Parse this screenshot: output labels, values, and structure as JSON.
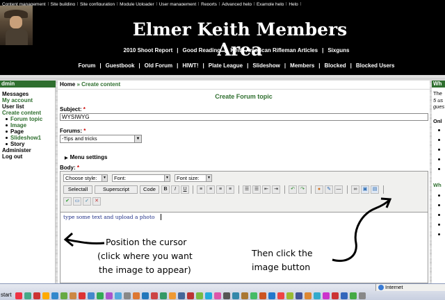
{
  "admin_bar": {
    "items": [
      "Content management",
      "Site building",
      "Site configuration",
      "Module Uploader",
      "User management",
      "Reports",
      "Advanced help",
      "Example help",
      "Help"
    ]
  },
  "header": {
    "site_title": "Elmer Keith Members Area",
    "primary_links": [
      "2010 Shoot Report",
      "Good Reading",
      "Keith American Rifleman Articles",
      "Sixguns"
    ],
    "secondary_links": [
      "Forum",
      "Guestbook",
      "Old Forum",
      "HIWT!",
      "Plate League",
      "Slideshow",
      "Members",
      "Blocked",
      "Blocked Users"
    ]
  },
  "sidebar": {
    "title": "dmin",
    "items": [
      {
        "label": "Messages",
        "style": "black"
      },
      {
        "label": "My account",
        "style": "green"
      },
      {
        "label": "User list",
        "style": "black"
      },
      {
        "label": "Create content",
        "style": "green"
      },
      {
        "label": "Forum topic",
        "style": "sub"
      },
      {
        "label": "Image",
        "style": "sub"
      },
      {
        "label": "Page",
        "style": "sub-black"
      },
      {
        "label": "Slideshow1",
        "style": "sub"
      },
      {
        "label": "Story",
        "style": "sub-black"
      },
      {
        "label": "Administer",
        "style": "black"
      },
      {
        "label": "Log out",
        "style": "black"
      }
    ]
  },
  "breadcrumb": {
    "home": "Home",
    "sep": "»",
    "current": "Create content"
  },
  "page_heading": "Create Forum topic",
  "form": {
    "subject_label": "Subject:",
    "required_mark": "*",
    "subject_value": "WYSIWYG",
    "forums_label": "Forums:",
    "forums_selected": "-Tips and tricks",
    "menu_settings_label": "Menu settings",
    "body_label": "Body:"
  },
  "editor": {
    "style_select": "Choose style:",
    "font_select": "Font:",
    "font_size_select": "Font size:",
    "buttons": [
      "Selectall",
      "Superscript",
      "Code"
    ],
    "format_buttons": [
      "B",
      "I",
      "U"
    ],
    "icons": [
      "align-left-icon",
      "align-center-icon",
      "align-right-icon",
      "align-justify-icon",
      "ordered-list-icon",
      "unordered-list-icon",
      "outdent-icon",
      "indent-icon",
      "undo-icon",
      "redo-icon",
      "color-icon",
      "cleanup-icon",
      "horizontal-rule-icon",
      "link-icon",
      "image-icon",
      "media-icon",
      "save-icon",
      "preview-icon",
      "spellcheck-icon",
      "fullscreen-icon"
    ],
    "content_text": "type some text and upload a photo"
  },
  "annotations": {
    "cursor_note": [
      "Position the cursor",
      "(click where you want",
      "the image to appear)"
    ],
    "image_note": [
      "Then click the",
      "image button"
    ]
  },
  "right_panel": {
    "title": "Wh",
    "lines": [
      "The",
      "5 us",
      "gues"
    ],
    "online_heading": "Onl",
    "bottom_heading": "Wh"
  },
  "taskbar": {
    "start_label": "start",
    "zone_label": "Internet"
  },
  "colors": {
    "accent_green": "#2f6f2f",
    "required_red": "#cc0000",
    "header_black": "#000000"
  }
}
